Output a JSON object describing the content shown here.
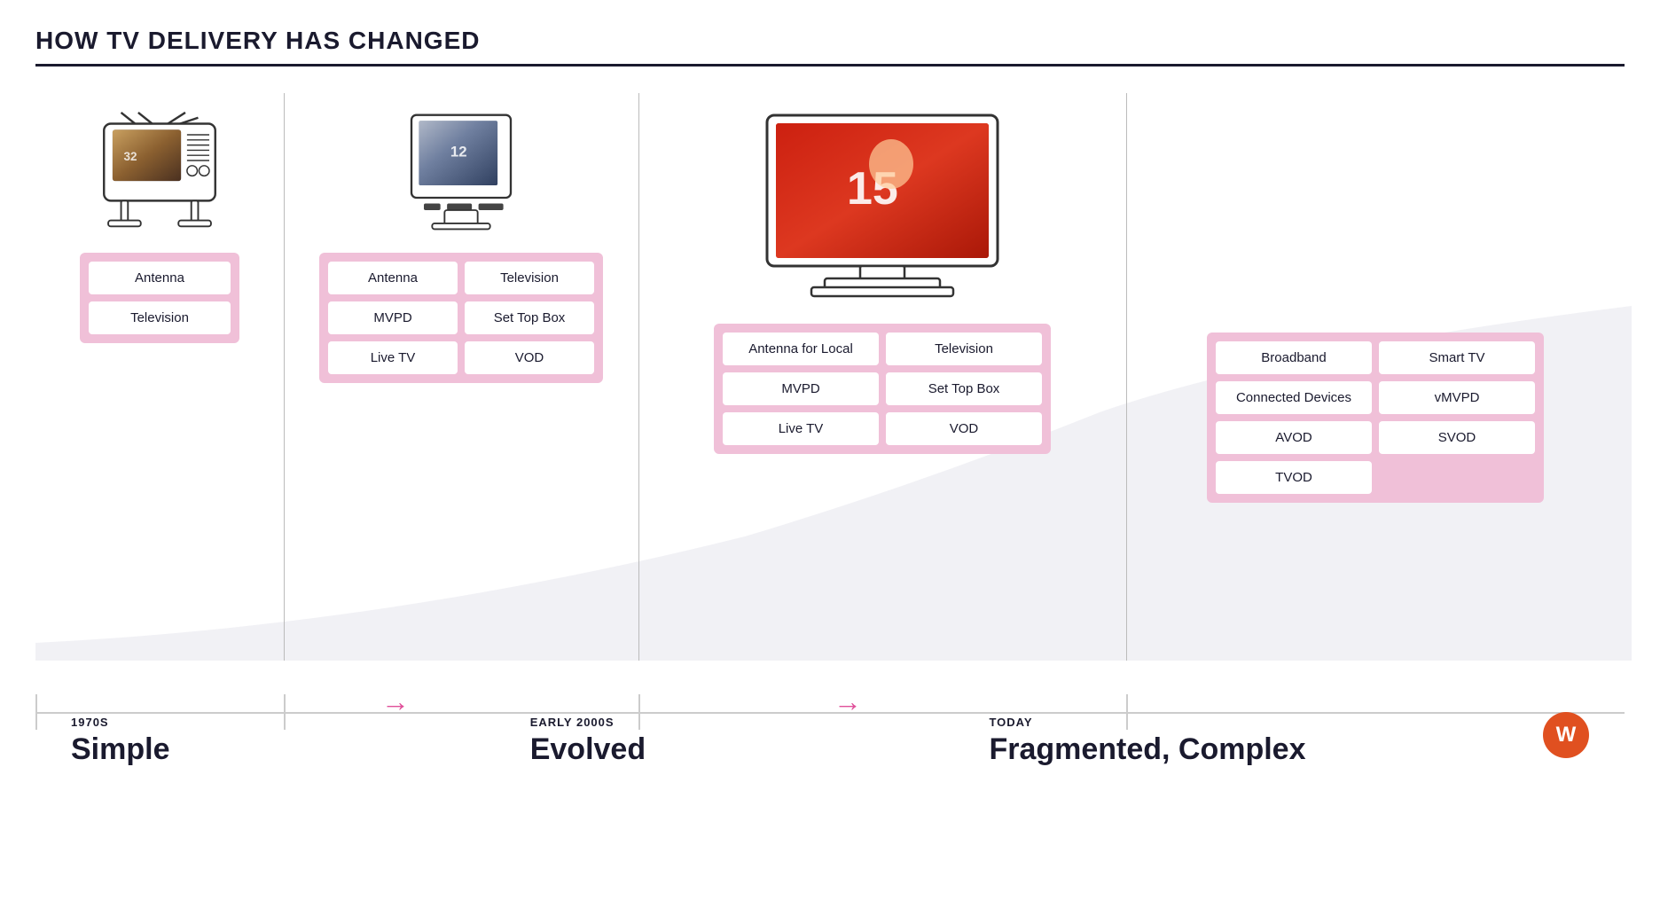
{
  "title": "HOW TV DELIVERY HAS CHANGED",
  "eras": [
    {
      "id": "1970s",
      "period_label": "1970s",
      "era_label": "Simple",
      "cards": [
        "Antenna",
        "Television"
      ]
    },
    {
      "id": "early2000s",
      "period_label": "EARLY 2000s",
      "era_label": "Evolved",
      "cards": [
        "Antenna",
        "Television",
        "MVPD",
        "Set Top Box",
        "Live TV",
        "VOD"
      ]
    },
    {
      "id": "today_left",
      "period_label": "TODAY",
      "era_label": "Fragmented, Complex",
      "cards": [
        "Antenna for Local",
        "Television",
        "MVPD",
        "Set Top Box",
        "Live TV",
        "VOD"
      ]
    },
    {
      "id": "today_right",
      "period_label": "",
      "era_label": "",
      "cards": [
        "Broadband",
        "Smart TV",
        "Connected Devices",
        "vMVPD",
        "AVOD",
        "SVOD",
        "TVOD",
        ""
      ]
    }
  ],
  "arrows": [
    "→",
    "→"
  ],
  "logo": "W"
}
